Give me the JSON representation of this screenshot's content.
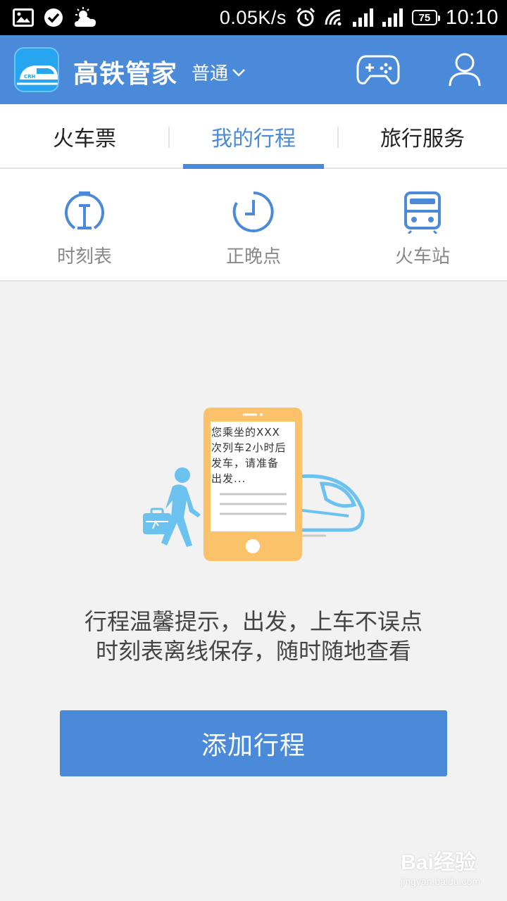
{
  "status_bar": {
    "net_speed": "0.05K/s",
    "battery": "75",
    "time": "10:10",
    "icons": [
      "gallery-icon",
      "check-circle-icon",
      "weather-icon",
      "alarm-icon",
      "wifi-icon",
      "signal-icon",
      "signal-icon",
      "battery-icon"
    ]
  },
  "header": {
    "app_name": "高铁管家",
    "mode": "普通",
    "icons": [
      "app-logo",
      "chevron-down-icon",
      "gamepad-icon",
      "user-icon"
    ],
    "color": "#4a8ad9"
  },
  "tabs": [
    {
      "label": "火车票",
      "active": false
    },
    {
      "label": "我的行程",
      "active": true
    },
    {
      "label": "旅行服务",
      "active": false
    }
  ],
  "quick_links": [
    {
      "label": "时刻表",
      "icon": "timetable-icon"
    },
    {
      "label": "正晚点",
      "icon": "clock-icon"
    },
    {
      "label": "火车站",
      "icon": "train-station-icon"
    }
  ],
  "illustration": {
    "phone_message": "您乘坐的XXX\n次列车2小时后\n发车，请准备\n出发..."
  },
  "empty_state": {
    "line1": "行程温馨提示，出发，上车不误点",
    "line2": "时刻表离线保存，随时随地查看",
    "button": "添加行程"
  },
  "watermark": {
    "text": "Bai经验",
    "sub": "jingyan.baidu.com"
  }
}
